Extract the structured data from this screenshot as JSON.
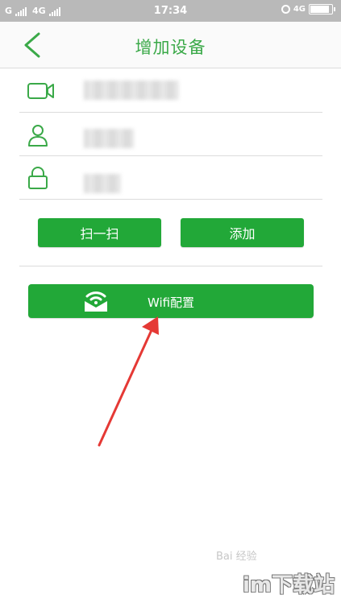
{
  "status_bar": {
    "carrier1": "G",
    "carrier2": "4G",
    "time": "17:34",
    "network_right": "4G",
    "battery_level": 0.92
  },
  "header": {
    "title": "增加设备",
    "back_icon": "chevron-left-icon"
  },
  "form": {
    "device_id": {
      "icon": "camera-icon",
      "value": ""
    },
    "username": {
      "icon": "user-icon",
      "value": ""
    },
    "password": {
      "icon": "lock-icon",
      "value": ""
    }
  },
  "buttons": {
    "scan_label": "扫一扫",
    "add_label": "添加",
    "wifi_label": "Wifi配置"
  },
  "watermark": {
    "site": "im下载站",
    "baidu": "Bai 经验"
  },
  "colors": {
    "accent": "#22a838",
    "title": "#3aa948",
    "status_bar": "#b9b9b9",
    "arrow": "#e53935"
  }
}
